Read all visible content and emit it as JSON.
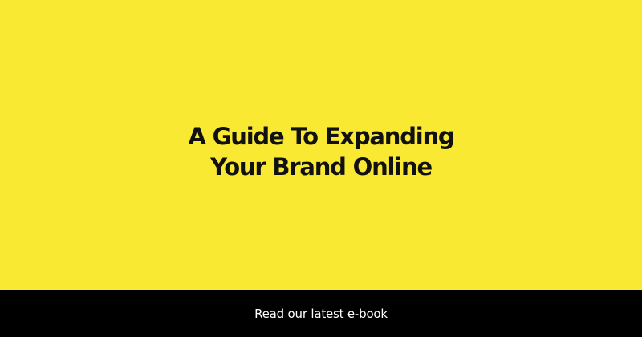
{
  "hero": {
    "headline_line1": "A Guide To Expanding",
    "headline_line2": "Your Brand Online"
  },
  "footer": {
    "cta_label": "Read our latest e-book"
  },
  "colors": {
    "background": "#f9e933",
    "headline_text": "#111111",
    "footer_background": "#000000",
    "footer_text": "#ffffff"
  }
}
